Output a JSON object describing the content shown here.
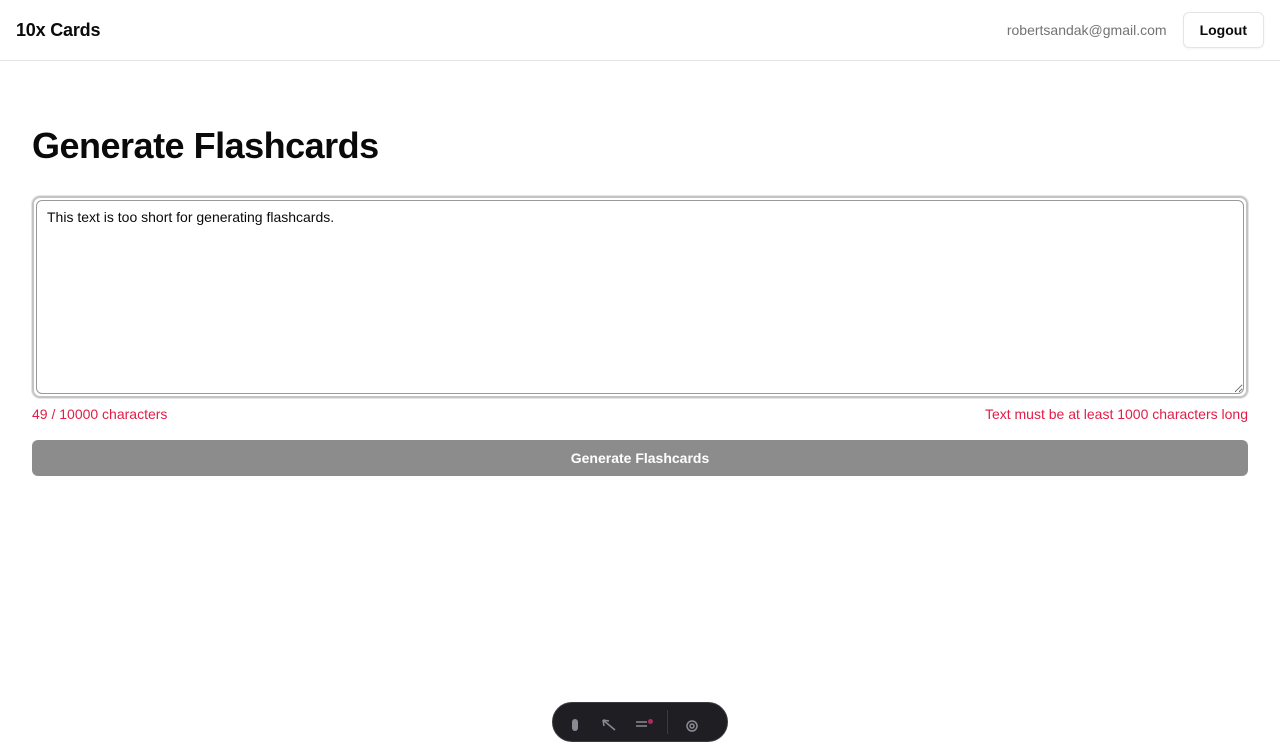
{
  "header": {
    "brand": "10x Cards",
    "user_email": "robertsandak@gmail.com",
    "logout_label": "Logout"
  },
  "main": {
    "title": "Generate Flashcards",
    "textarea_value": "This text is too short for generating flashcards.",
    "char_count": "49 / 10000 characters",
    "error_message": "Text must be at least 1000 characters long",
    "generate_label": "Generate Flashcards"
  },
  "dev_toolbar": {
    "icons": [
      "menu-icon",
      "inspect-icon",
      "audit-icon",
      "settings-icon"
    ]
  },
  "colors": {
    "error": "#e11d48",
    "button_disabled": "#8c8c8c",
    "toolbar_bg": "#1f1f23"
  }
}
